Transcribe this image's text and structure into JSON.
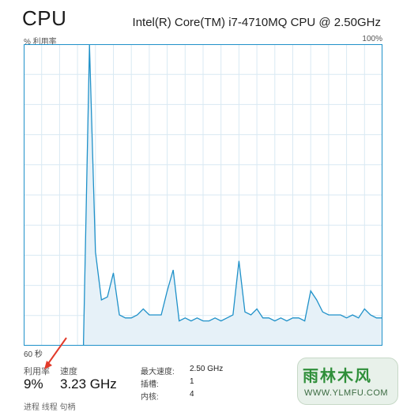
{
  "header": {
    "title": "CPU",
    "cpu_model": "Intel(R) Core(TM) i7-4710MQ CPU @ 2.50GHz"
  },
  "graph": {
    "y_label": "% 利用率",
    "y_max_label": "100%",
    "x_label": "60 秒",
    "colors": {
      "line": "#1f91c9",
      "fill": "#e6f1f8",
      "grid": "#d9e9f3",
      "border": "#1f91c9"
    }
  },
  "chart_data": {
    "type": "area",
    "x": [
      0,
      1,
      2,
      3,
      4,
      5,
      6,
      7,
      8,
      9,
      10,
      11,
      12,
      13,
      14,
      15,
      16,
      17,
      18,
      19,
      20,
      21,
      22,
      23,
      24,
      25,
      26,
      27,
      28,
      29,
      30,
      31,
      32,
      33,
      34,
      35,
      36,
      37,
      38,
      39,
      40,
      41,
      42,
      43,
      44,
      45,
      46,
      47,
      48,
      49,
      50,
      51,
      52,
      53,
      54,
      55,
      56,
      57,
      58,
      59,
      60
    ],
    "y": [
      null,
      null,
      null,
      null,
      null,
      null,
      null,
      null,
      null,
      null,
      null,
      null,
      null,
      null,
      null,
      null,
      null,
      null,
      null,
      null,
      null,
      null,
      null,
      null,
      null,
      null,
      null,
      null,
      null,
      null,
      null,
      null,
      null,
      null,
      null,
      null,
      null,
      null,
      null,
      null,
      null,
      null,
      null,
      null,
      null,
      null,
      null,
      null,
      null,
      null,
      null,
      null,
      null,
      null,
      null,
      null,
      null,
      null,
      null,
      null,
      null
    ],
    "values": [
      0,
      0,
      0,
      0,
      0,
      0,
      0,
      0,
      0,
      0,
      1,
      100,
      31,
      15,
      16,
      24,
      10,
      9,
      9,
      10,
      12,
      10,
      10,
      10,
      18,
      25,
      8,
      9,
      8,
      9,
      8,
      8,
      9,
      8,
      9,
      10,
      28,
      11,
      10,
      12,
      9,
      9,
      8,
      9,
      8,
      9,
      9,
      8,
      18,
      15,
      11,
      10,
      10,
      10,
      9,
      10,
      9,
      12,
      10,
      9,
      9
    ],
    "xlim": [
      0,
      60
    ],
    "ylim": [
      0,
      100
    ],
    "grid": true,
    "xlabel": "60 秒",
    "ylabel": "% 利用率"
  },
  "stats": {
    "utilization_label": "利用率",
    "utilization_value": "9%",
    "speed_label": "速度",
    "speed_value": "3.23 GHz",
    "max_speed_label": "最大速度:",
    "max_speed_value": "2.50 GHz",
    "sockets_label": "插槽:",
    "sockets_value": "1",
    "cores_label": "内核:",
    "cores_value": "4",
    "partial_labels": "进程      线程      句柄"
  },
  "watermark": {
    "text_cn": "雨林木风",
    "url": "WWW.YLMFU.COM"
  }
}
